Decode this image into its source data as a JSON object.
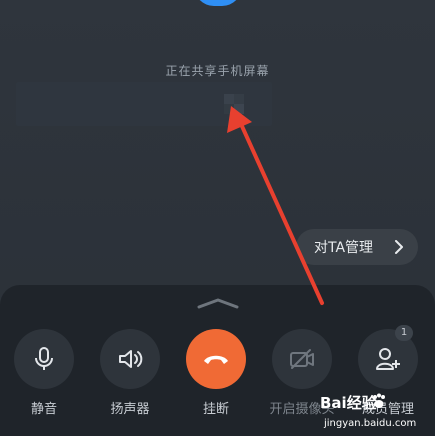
{
  "screen": {
    "share_status": "正在共享手机屏幕",
    "manage_label": "对TA管理"
  },
  "controls": [
    {
      "label": "静音",
      "icon": "mic-icon"
    },
    {
      "label": "扬声器",
      "icon": "speaker-icon"
    },
    {
      "label": "挂断",
      "icon": "hangup-icon"
    },
    {
      "label": "开启摄像头",
      "icon": "camera-off-icon"
    },
    {
      "label": "成员管理",
      "icon": "add-member-icon"
    }
  ],
  "badge": "1",
  "watermark": {
    "logo": "Bai经验",
    "url": "jingyan.baidu.com"
  },
  "colors": {
    "hangup": "#f06a35",
    "arrow": "#e8402f",
    "avatar": "#2f8ff5"
  }
}
